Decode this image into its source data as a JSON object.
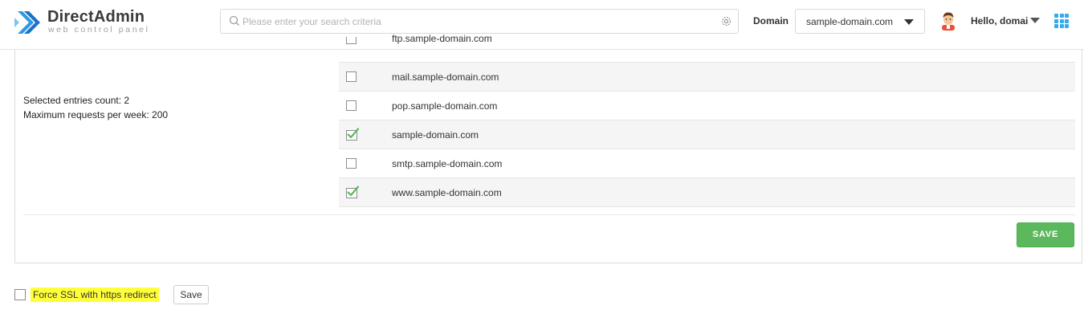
{
  "header": {
    "logo_title": "DirectAdmin",
    "logo_subtitle": "web control panel",
    "search_placeholder": "Please enter your search criteria",
    "domain_label": "Domain",
    "domain_value": "sample-domain.com",
    "greeting": "Hello, domai"
  },
  "panel": {
    "selected_count": "Selected entries count: 2",
    "max_requests": "Maximum requests per week: 200",
    "rows": [
      {
        "name": "ftp.sample-domain.com",
        "checked": false
      },
      {
        "name": "mail.sample-domain.com",
        "checked": false
      },
      {
        "name": "pop.sample-domain.com",
        "checked": false
      },
      {
        "name": "sample-domain.com",
        "checked": true
      },
      {
        "name": "smtp.sample-domain.com",
        "checked": false
      },
      {
        "name": "www.sample-domain.com",
        "checked": true
      }
    ],
    "save_label": "SAVE"
  },
  "footer": {
    "force_ssl_label": "Force SSL with https redirect",
    "save_label": "Save"
  },
  "colors": {
    "accent": "#5cb85c",
    "highlight": "#ffff3a",
    "brand": "#1f8ee6"
  }
}
